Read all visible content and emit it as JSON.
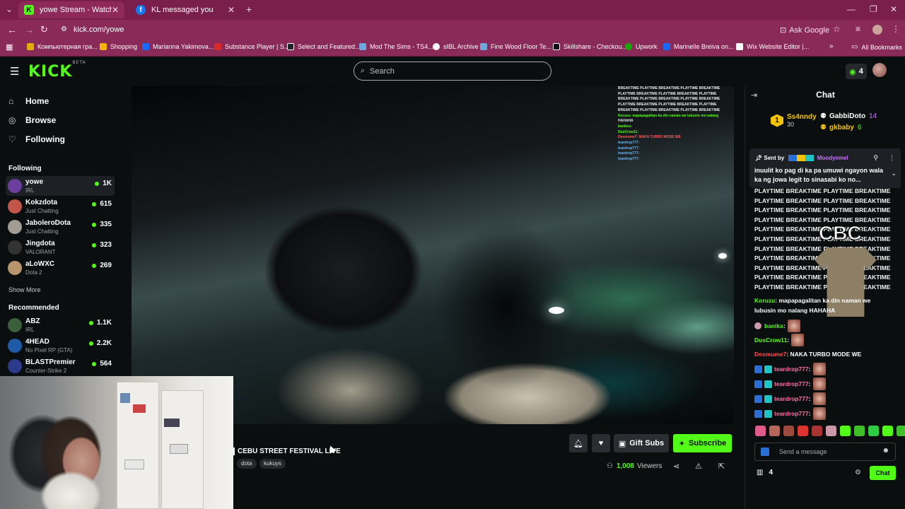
{
  "browser": {
    "tabs": [
      {
        "title": "yowe Stream - Watch Live o",
        "icon": "kick-favicon",
        "color": "#53fc18"
      },
      {
        "title": "KL messaged you",
        "icon": "facebook-favicon",
        "color": "#1877f2"
      }
    ],
    "url": "kick.com/yowe",
    "ask_google": "Ask Google",
    "bookmarks": [
      {
        "label": "Компьютерная гра...",
        "color": "#e0b000"
      },
      {
        "label": "Shopping",
        "color": "#f4b400"
      },
      {
        "label": "Marianna Yakimova...",
        "color": "#1769ff"
      },
      {
        "label": "Substance Player | S...",
        "color": "#d92a2a"
      },
      {
        "label": "Select and Featured...",
        "color": "#222222"
      },
      {
        "label": "Mod The Sims - TS4...",
        "color": "#6fa8dc"
      },
      {
        "label": "sIBL Archive",
        "color": "#ffffff"
      },
      {
        "label": "Fine Wood Floor Te...",
        "color": "#6fa8dc"
      },
      {
        "label": "Skillshare - Checkou...",
        "color": "#111111"
      },
      {
        "label": "Upwork",
        "color": "#14a800"
      },
      {
        "label": "Marinelle Breiva on...",
        "color": "#1769ff"
      },
      {
        "label": "Wix Website Editor |...",
        "color": "#ffffff"
      }
    ],
    "all_bookmarks": "All Bookmarks"
  },
  "kick": {
    "logo": "KICK",
    "logo_tag": "BETA",
    "search_placeholder": "Search",
    "kicks_count": "4",
    "nav": [
      {
        "label": "Home",
        "icon": "home-icon"
      },
      {
        "label": "Browse",
        "icon": "compass-icon"
      },
      {
        "label": "Following",
        "icon": "heart-icon"
      }
    ],
    "following_header": "Following",
    "following": [
      {
        "name": "yowe",
        "category": "IRL",
        "viewers": "1K",
        "color": "#6b3fa0"
      },
      {
        "name": "Kokzdota",
        "category": "Just Chatting",
        "viewers": "615",
        "color": "#c2554a"
      },
      {
        "name": "JaboleroDota",
        "category": "Just Chatting",
        "viewers": "335",
        "color": "#a19d95"
      },
      {
        "name": "Jingdota",
        "category": "VALORANT",
        "viewers": "323",
        "color": "#333333"
      },
      {
        "name": "aLoWXC",
        "category": "Dota 2",
        "viewers": "269",
        "color": "#b8966b"
      }
    ],
    "show_more": "Show More",
    "recommended_header": "Recommended",
    "recommended": [
      {
        "name": "ABZ",
        "category": "IRL",
        "viewers": "1.1K",
        "color": "#3a5f3a"
      },
      {
        "name": "4HEAD",
        "category": "No Pixel RP (GTA)",
        "viewers": "2.2K",
        "color": "#1e5aa8"
      },
      {
        "name": "BLASTPremier",
        "category": "Counter-Strike 2",
        "viewers": "564",
        "color": "#2b3a8a"
      }
    ]
  },
  "stream": {
    "title": "CEBU STREET FESTIVAL LIVE",
    "tags": [
      "dota",
      "kukuys"
    ],
    "gift_subs": "Gift Subs",
    "subscribe": "Subscribe",
    "viewers": "1,008",
    "viewers_label": "Viewers",
    "overlay_lines": [
      {
        "t": "BREAKTIME PLAYTIME BREAKTIME PLAYTIME BREAKTIME",
        "c": ""
      },
      {
        "t": "PLAYTIME BREAKTIME PLAYTIME BREAKTIME PLAYTIME",
        "c": ""
      },
      {
        "t": "BREAKTIME PLAYTIME BREAKTIME PLAYTIME BREAKTIME",
        "c": ""
      },
      {
        "t": "PLAYTIME BREAKTIME PLAYTIME BREAKTIME PLAYTIME",
        "c": ""
      },
      {
        "t": "BREAKTIME PLAYTIME BREAKTIME PLAYTIME BREAKTIME",
        "c": ""
      },
      {
        "t": "Koruzu: mapapagalitan ka din naman we lubusin mo nalang",
        "c": "g"
      },
      {
        "t": "HAHAHA",
        "c": ""
      },
      {
        "t": "banikss:",
        "c": "g"
      },
      {
        "t": "DusCrow11:",
        "c": "g"
      },
      {
        "t": "Desmume7: NAKA TURBO MODE WE",
        "c": "r"
      },
      {
        "t": "teardrop777:",
        "c": "b"
      },
      {
        "t": "teardrop777:",
        "c": "b"
      },
      {
        "t": "teardrop777:",
        "c": "b"
      },
      {
        "t": "teardrop777:",
        "c": "b"
      }
    ]
  },
  "chat": {
    "header": "Chat",
    "gifters": [
      {
        "name": "Ss4nndy",
        "count": "30",
        "rank": "1",
        "color": "#f5c400"
      },
      {
        "name": "GabbiDoto",
        "count": "14",
        "color": "#ffffff"
      },
      {
        "name": "gkbaby",
        "count": "6",
        "color": "#f5c400"
      }
    ],
    "pinned": {
      "sent_by": "Sent by",
      "user": "Moodyemel",
      "message": "inuulit ko pag di ka pa umuwi ngayon wala ka ng jowa legit to sinasabi ko no..."
    },
    "spam_lines": [
      "PLAYTIME BREAKTIME PLAYTIME BREAKTIME",
      "PLAYTIME BREAKTIME PLAYTIME BREAKTIME",
      "PLAYTIME BREAKTIME PLAYTIME BREAKTIME",
      "PLAYTIME BREAKTIME PLAYTIME BREAKTIME",
      "PLAYTIME BREAKTIME PLAYTIME BREAKTIME",
      "PLAYTIME BREAKTIME PLAYTIME BREAKTIME",
      "PLAYTIME BREAKTIME PLAYTIME BREAKTIME",
      "PLAYTIME BREAKTIME PLAYTIME BREAKTIME",
      "PLAYTIME BREAKTIME PLAYTIME BREAKTIME",
      "PLAYTIME BREAKTIME PLAYTIME BREAKTIME",
      "PLAYTIME BREAKTIME PLAYTIME BREAKTIME"
    ],
    "overlay_logo": "CBC",
    "messages": [
      {
        "user": "Koruzu",
        "text": ": mapapagalitan ka din naman we",
        "color": "#53fc18"
      },
      {
        "user": "",
        "text": "lubusin mo nalang HAHAHA",
        "color": "#ffffff"
      },
      {
        "user": "baniks",
        "text": ":",
        "color": "#53fc18"
      },
      {
        "user": "DusCrow11",
        "text": ":",
        "color": "#53fc18"
      },
      {
        "user": "Desmume7",
        "text": ": NAKA TURBO MODE WE",
        "color": "#ff4d4d"
      },
      {
        "user": "teardrop777",
        "text": ":",
        "color": "#ff6fa0"
      },
      {
        "user": "teardrop777",
        "text": ":",
        "color": "#ff6fa0"
      },
      {
        "user": "teardrop777",
        "text": ":",
        "color": "#ff6fa0"
      },
      {
        "user": "teardrop777",
        "text": ":",
        "color": "#ff6fa0"
      }
    ],
    "input_placeholder": "Send a message",
    "points": "4",
    "send_label": "Chat"
  },
  "colors": {
    "kick_green": "#53fc18",
    "browser_tab": "#7a1f4b",
    "bg": "#0b0e0f"
  }
}
